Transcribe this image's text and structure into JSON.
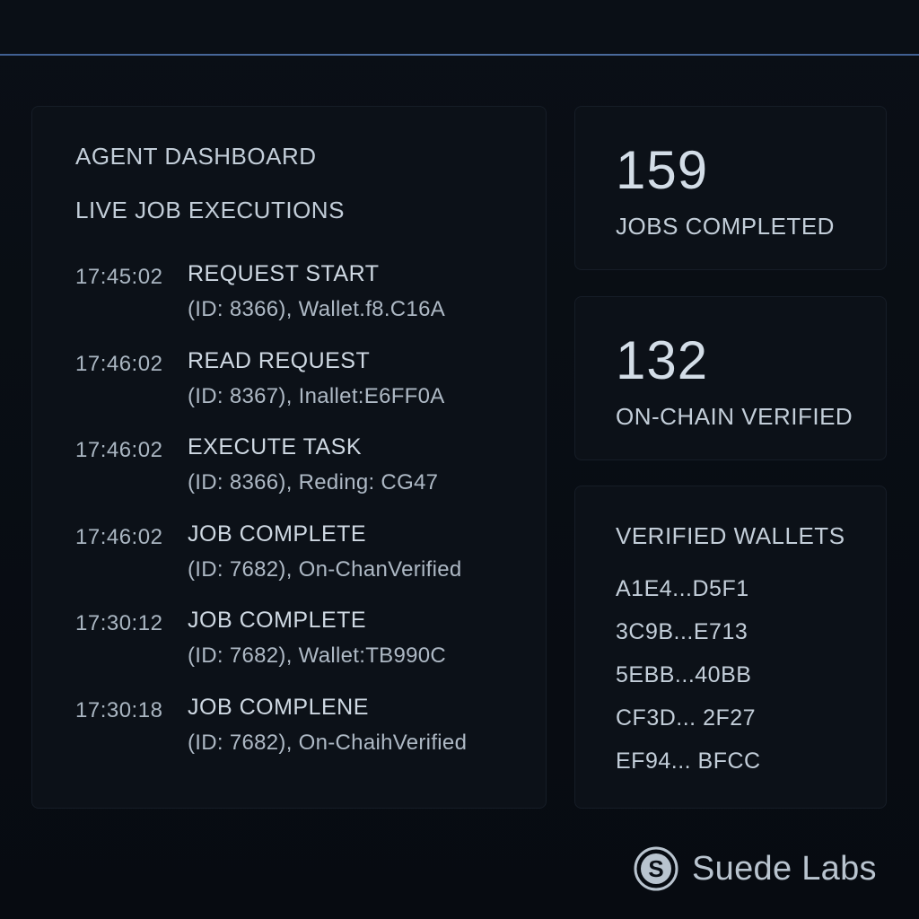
{
  "dashboard": {
    "title": "AGENT DASHBOARD",
    "section_title": "LIVE JOB EXECUTIONS",
    "log": [
      {
        "time": "17:45:02",
        "event": "REQUEST START",
        "detail": "(ID: 8366), Wallet.f8.C16A"
      },
      {
        "time": "17:46:02",
        "event": "READ REQUEST",
        "detail": "(ID: 8367), Inallet:E6FF0A"
      },
      {
        "time": "17:46:02",
        "event": "EXECUTE TASK",
        "detail": "(ID: 8366), Reding: CG47"
      },
      {
        "time": "17:46:02",
        "event": "JOB COMPLETE",
        "detail": "(ID: 7682), On-ChanVerified"
      },
      {
        "time": "17:30:12",
        "event": "JOB COMPLETE",
        "detail": "(ID: 7682), Wallet:TB990C"
      },
      {
        "time": "17:30:18",
        "event": "JOB COMPLENE",
        "detail": "(ID: 7682), On-ChaihVerified"
      }
    ]
  },
  "stats": {
    "jobs_completed": {
      "value": "159",
      "label": "JOBS COMPLETED"
    },
    "on_chain_verified": {
      "value": "132",
      "label": "ON-CHAIN VERIFIED"
    }
  },
  "wallets": {
    "title": "VERIFIED WALLETS",
    "items": [
      "A1E4...D5F1",
      "3C9B...E713",
      "5EBB...40BB",
      "CF3D... 2F27",
      "EF94... BFCC"
    ]
  },
  "brand": {
    "name": "Suede Labs",
    "logo_icon": "suede-labs-s-logo-icon"
  },
  "colors": {
    "background": "#070b11",
    "panel": "#0c1118",
    "accent_line": "#4a6ea8",
    "text": "#c3ced9"
  }
}
